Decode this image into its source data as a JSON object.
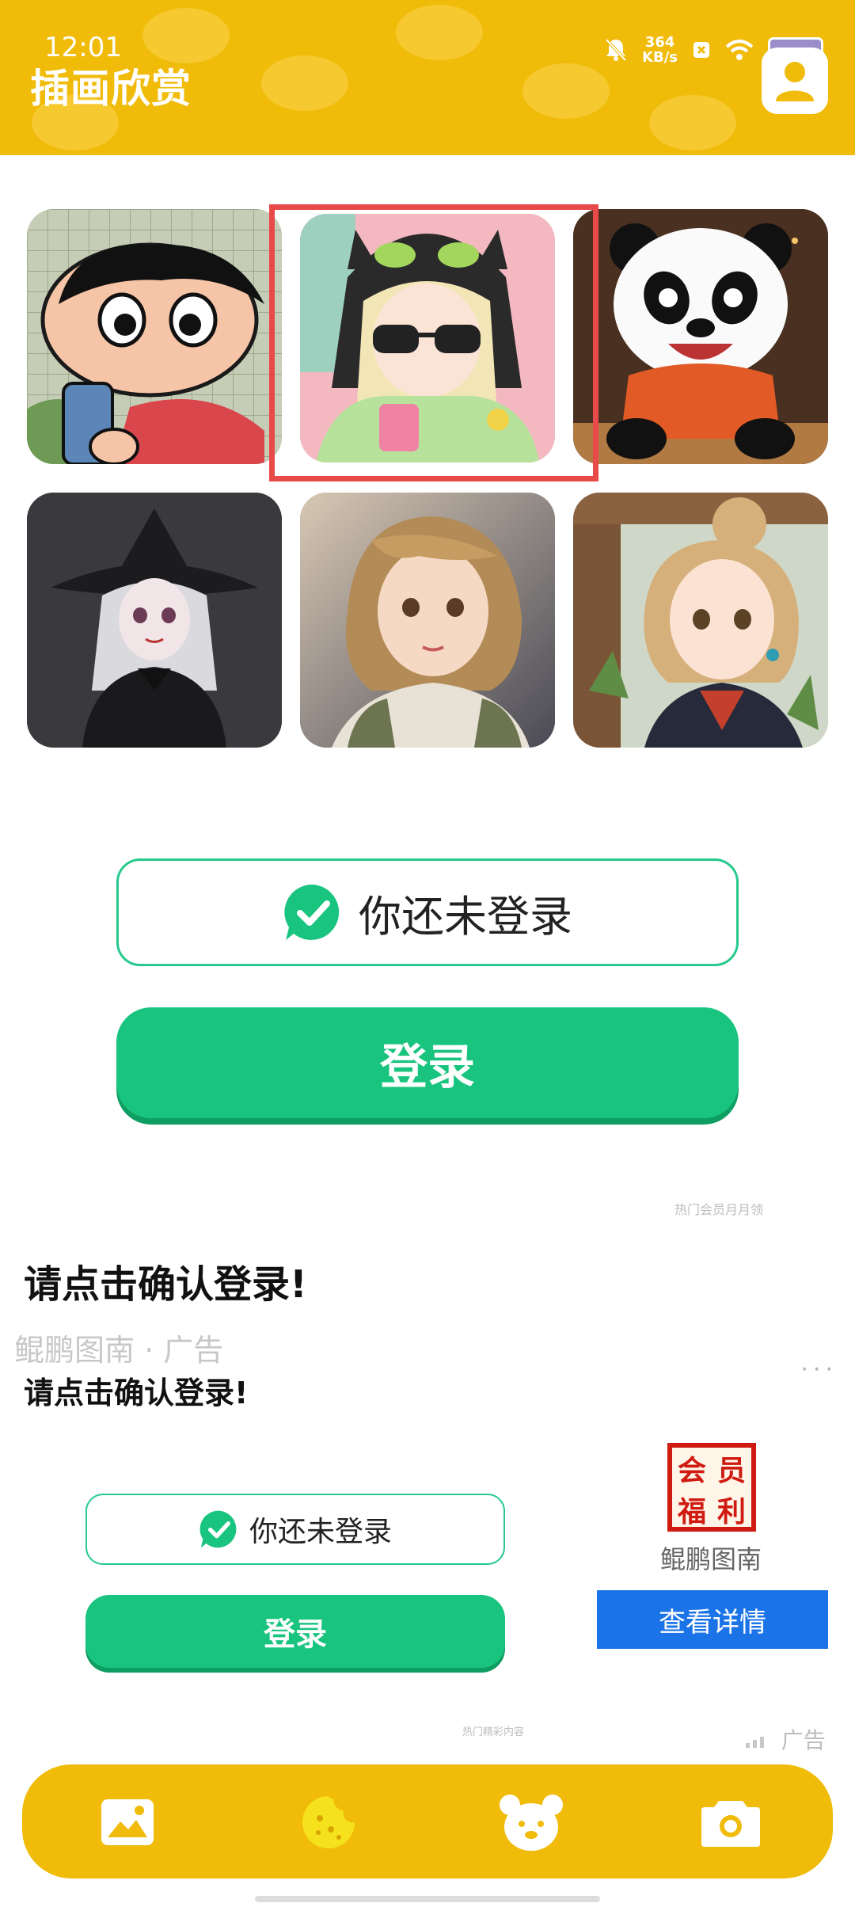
{
  "status_bar": {
    "time": "12:01",
    "net_speed_value": "364",
    "net_speed_unit": "KB/s"
  },
  "header": {
    "title": "插画欣赏",
    "avatar_icon": "user-avatar-icon"
  },
  "gallery": {
    "selected_index": 1,
    "tiles": [
      {
        "icon": "crayon-boy-illustration"
      },
      {
        "icon": "cat-hood-girl-illustration"
      },
      {
        "icon": "panda-illustration"
      },
      {
        "icon": "witch-girl-illustration"
      },
      {
        "icon": "short-hair-girl-illustration"
      },
      {
        "icon": "bun-hair-girl-illustration"
      }
    ]
  },
  "login": {
    "status_text": "你还未登录",
    "button_label": "登录"
  },
  "ad": {
    "top_tiny": "热门会员月月领",
    "heading": "请点击确认登录!",
    "sponsor_faded": "鲲鹏图南 · 广告",
    "heading2": "请点击确认登录!",
    "status_text": "你还未登录",
    "button_label": "登录",
    "badge_chars": [
      "会",
      "员",
      "福",
      "利"
    ],
    "name": "鲲鹏图南",
    "detail_button": "查看详情",
    "bottom_tiny": "热门精彩内容",
    "ad_label": "广告",
    "more": "···"
  },
  "nav": {
    "items": [
      {
        "icon": "image-icon"
      },
      {
        "icon": "cookie-icon"
      },
      {
        "icon": "bear-icon"
      },
      {
        "icon": "camera-icon"
      }
    ]
  },
  "colors": {
    "primary_yellow": "#f0bb09",
    "green": "#19c47e",
    "blue": "#1b73e8",
    "highlight_red": "#e84a4a"
  }
}
